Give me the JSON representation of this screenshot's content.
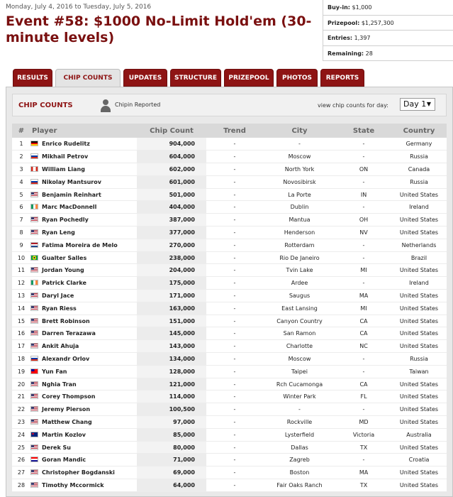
{
  "header": {
    "dates": "Monday, July 4, 2016 to Tuesday, July 5, 2016",
    "title": "Event #58: $1000 No-Limit Hold'em (30-minute levels)"
  },
  "info": {
    "buyin_label": "Buy-in:",
    "buyin_value": "$1,000",
    "prizepool_label": "Prizepool:",
    "prizepool_value": "$1,257,300",
    "entries_label": "Entries:",
    "entries_value": "1,397",
    "remaining_label": "Remaining:",
    "remaining_value": "28"
  },
  "tabs": [
    {
      "label": "RESULTS"
    },
    {
      "label": "CHIP COUNTS"
    },
    {
      "label": "UPDATES"
    },
    {
      "label": "STRUCTURE"
    },
    {
      "label": "PRIZEPOOL"
    },
    {
      "label": "PHOTOS"
    },
    {
      "label": "REPORTS"
    }
  ],
  "subheader": {
    "title": "CHIP COUNTS",
    "chipin": "Chipin Reported",
    "view_label": "view chip counts for day:",
    "day_selected": "Day 1"
  },
  "columns": [
    "#",
    "Player",
    "Chip Count",
    "Trend",
    "City",
    "State",
    "Country"
  ],
  "rows": [
    {
      "rank": "1",
      "player": "Enrico Rudelitz",
      "chips": "904,000",
      "trend": "-",
      "city": "-",
      "state": "-",
      "country": "Germany",
      "flag": "de"
    },
    {
      "rank": "2",
      "player": "Mikhail Petrov",
      "chips": "604,000",
      "trend": "-",
      "city": "Moscow",
      "state": "-",
      "country": "Russia",
      "flag": "ru"
    },
    {
      "rank": "3",
      "player": "William Liang",
      "chips": "602,000",
      "trend": "-",
      "city": "North York",
      "state": "ON",
      "country": "Canada",
      "flag": "ca"
    },
    {
      "rank": "4",
      "player": "Nikolay Mantsurov",
      "chips": "601,000",
      "trend": "-",
      "city": "Novosibirsk",
      "state": "-",
      "country": "Russia",
      "flag": "ru"
    },
    {
      "rank": "5",
      "player": "Benjamin Reinhart",
      "chips": "501,000",
      "trend": "-",
      "city": "La Porte",
      "state": "IN",
      "country": "United States",
      "flag": "us"
    },
    {
      "rank": "6",
      "player": "Marc MacDonnell",
      "chips": "404,000",
      "trend": "-",
      "city": "Dublin",
      "state": "-",
      "country": "Ireland",
      "flag": "ie"
    },
    {
      "rank": "7",
      "player": "Ryan Pochedly",
      "chips": "387,000",
      "trend": "-",
      "city": "Mantua",
      "state": "OH",
      "country": "United States",
      "flag": "us"
    },
    {
      "rank": "8",
      "player": "Ryan Leng",
      "chips": "377,000",
      "trend": "-",
      "city": "Henderson",
      "state": "NV",
      "country": "United States",
      "flag": "us"
    },
    {
      "rank": "9",
      "player": "Fatima Moreira de Melo",
      "chips": "270,000",
      "trend": "-",
      "city": "Rotterdam",
      "state": "-",
      "country": "Netherlands",
      "flag": "nl"
    },
    {
      "rank": "10",
      "player": "Gualter Salles",
      "chips": "238,000",
      "trend": "-",
      "city": "Rio De Janeiro",
      "state": "-",
      "country": "Brazil",
      "flag": "br"
    },
    {
      "rank": "11",
      "player": "Jordan Young",
      "chips": "204,000",
      "trend": "-",
      "city": "Tvin Lake",
      "state": "MI",
      "country": "United States",
      "flag": "us"
    },
    {
      "rank": "12",
      "player": "Patrick Clarke",
      "chips": "175,000",
      "trend": "-",
      "city": "Ardee",
      "state": "-",
      "country": "Ireland",
      "flag": "ie"
    },
    {
      "rank": "13",
      "player": "Daryl Jace",
      "chips": "171,000",
      "trend": "-",
      "city": "Saugus",
      "state": "MA",
      "country": "United States",
      "flag": "us"
    },
    {
      "rank": "14",
      "player": "Ryan Riess",
      "chips": "163,000",
      "trend": "-",
      "city": "East Lansing",
      "state": "MI",
      "country": "United States",
      "flag": "us"
    },
    {
      "rank": "15",
      "player": "Brett Robinson",
      "chips": "151,000",
      "trend": "-",
      "city": "Canyon Country",
      "state": "CA",
      "country": "United States",
      "flag": "us"
    },
    {
      "rank": "16",
      "player": "Darren Terazawa",
      "chips": "145,000",
      "trend": "-",
      "city": "San Ramon",
      "state": "CA",
      "country": "United States",
      "flag": "us"
    },
    {
      "rank": "17",
      "player": "Ankit Ahuja",
      "chips": "143,000",
      "trend": "-",
      "city": "Charlotte",
      "state": "NC",
      "country": "United States",
      "flag": "us"
    },
    {
      "rank": "18",
      "player": "Alexandr Orlov",
      "chips": "134,000",
      "trend": "-",
      "city": "Moscow",
      "state": "-",
      "country": "Russia",
      "flag": "ru"
    },
    {
      "rank": "19",
      "player": "Yun Fan",
      "chips": "128,000",
      "trend": "-",
      "city": "Taipei",
      "state": "-",
      "country": "Taiwan",
      "flag": "tw"
    },
    {
      "rank": "20",
      "player": "Nghia Tran",
      "chips": "121,000",
      "trend": "-",
      "city": "Rch Cucamonga",
      "state": "CA",
      "country": "United States",
      "flag": "us"
    },
    {
      "rank": "21",
      "player": "Corey Thompson",
      "chips": "114,000",
      "trend": "-",
      "city": "Winter Park",
      "state": "FL",
      "country": "United States",
      "flag": "us"
    },
    {
      "rank": "22",
      "player": "Jeremy Pierson",
      "chips": "100,500",
      "trend": "-",
      "city": "-",
      "state": "-",
      "country": "United States",
      "flag": "us"
    },
    {
      "rank": "23",
      "player": "Matthew Chang",
      "chips": "97,000",
      "trend": "-",
      "city": "Rockville",
      "state": "MD",
      "country": "United States",
      "flag": "us"
    },
    {
      "rank": "24",
      "player": "Martin Kozlov",
      "chips": "85,000",
      "trend": "-",
      "city": "Lysterfield",
      "state": "Victoria",
      "country": "Australia",
      "flag": "au"
    },
    {
      "rank": "25",
      "player": "Derek Su",
      "chips": "80,000",
      "trend": "-",
      "city": "Dallas",
      "state": "TX",
      "country": "United States",
      "flag": "us"
    },
    {
      "rank": "26",
      "player": "Goran Mandic",
      "chips": "71,000",
      "trend": "-",
      "city": "Zagreb",
      "state": "-",
      "country": "Croatia",
      "flag": "hr"
    },
    {
      "rank": "27",
      "player": "Christopher Bogdanski",
      "chips": "69,000",
      "trend": "-",
      "city": "Boston",
      "state": "MA",
      "country": "United States",
      "flag": "us"
    },
    {
      "rank": "28",
      "player": "Timothy Mccormick",
      "chips": "64,000",
      "trend": "-",
      "city": "Fair Oaks Ranch",
      "state": "TX",
      "country": "United States",
      "flag": "us"
    }
  ],
  "flag_styles": {
    "de": "linear-gradient(#000 0 33%, #dd0000 33% 66%, #ffce00 66%)",
    "ru": "linear-gradient(#ffffff 0 33%, #0039a6 33% 66%, #d52b1e 66%)",
    "ca": "linear-gradient(90deg, #d52b1e 0 28%, #ffffff 28% 72%, #d52b1e 72%)",
    "us": "linear-gradient(#3c3b6e 0 0) 0 0 / 45% 55% no-repeat, repeating-linear-gradient(#b22234 0 1px, #ffffff 1px 2px)",
    "ie": "linear-gradient(90deg, #169b62 0 33%, #ffffff 33% 66%, #ff883e 66%)",
    "nl": "linear-gradient(#ae1c28 0 33%, #ffffff 33% 66%, #21468b 66%)",
    "br": "radial-gradient(circle, #002776 0 22%, #ffdf00 23% 48%, #009c3b 49%)",
    "tw": "linear-gradient(#000095 0 0) 0 0 / 50% 50% no-repeat, #fe0000",
    "au": "linear-gradient(#c8102e 0 0) 1px 1px / 3px 2px no-repeat, #00247d",
    "hr": "linear-gradient(#ff0000 0 33%, #ffffff 33% 66%, #171796 66%)"
  }
}
